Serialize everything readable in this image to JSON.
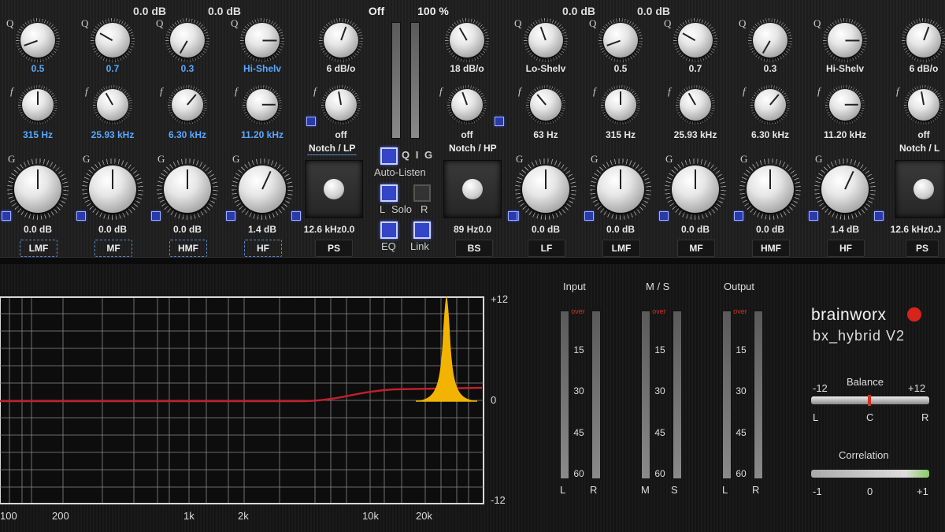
{
  "top_values": {
    "left_a": "0.0 dB",
    "left_b": "0.0 dB",
    "off": "Off",
    "pct": "100 %",
    "right_a": "0.0 dB",
    "right_b": "0.0 dB"
  },
  "row1": [
    "0.5",
    "0.7",
    "0.3",
    "Hi-Shelv",
    "6 dB/o",
    "18 dB/o",
    "Lo-Shelv",
    "0.5",
    "0.7",
    "0.3",
    "Hi-Shelv",
    "6 dB/o"
  ],
  "row2": [
    "315 Hz",
    "25.93 kHz",
    "6.30 kHz",
    "11.20 kHz",
    "off",
    "off",
    "63 Hz",
    "315 Hz",
    "25.93 kHz",
    "6.30 kHz",
    "11.20 kHz",
    "off"
  ],
  "row3": [
    "0.0 dB",
    "0.0 dB",
    "0.0 dB",
    "1.4 dB",
    "0.0 dB",
    "0.0 dB",
    "0.0 dB",
    "0.0 dB",
    "0.0 dB",
    "1.4 dB"
  ],
  "bands_left": [
    "LMF",
    "MF",
    "HMF",
    "HF"
  ],
  "bands_right": [
    "LF",
    "LMF",
    "MF",
    "HMF",
    "HF"
  ],
  "notch_lp": "Notch / LP",
  "notch_hp": "Notch / HP",
  "notch_l": "Notch / L",
  "ps_left": "12.6 kHz0.0",
  "ps_right": "12.6 kHz0.J",
  "bs_val": "89 Hz0.0",
  "ps_label": "PS",
  "bs_label": "BS",
  "qig": "Q I G",
  "auto_listen": "Auto-Listen",
  "solo_l": "L",
  "solo": "Solo",
  "solo_r": "R",
  "eq": "EQ",
  "link": "Link",
  "graph": {
    "top": "+12",
    "zero": "0",
    "bottom": "-12",
    "x": [
      "100",
      "200",
      "1k",
      "2k",
      "10k",
      "20k"
    ]
  },
  "meters": {
    "input": "Input",
    "ms": "M / S",
    "output": "Output",
    "over": "over",
    "scale": [
      "15",
      "30",
      "45",
      "60"
    ],
    "in_l": "L",
    "in_r": "R",
    "ms_m": "M",
    "ms_s": "S",
    "out_l": "L",
    "out_r": "R"
  },
  "brand": {
    "name": "brainworx",
    "product": "bx_hybrid V2"
  },
  "balance": {
    "label": "Balance",
    "min": "-12",
    "max": "+12",
    "l": "L",
    "c": "C",
    "r": "R"
  },
  "correlation": {
    "label": "Correlation",
    "min": "-1",
    "mid": "0",
    "max": "+1"
  },
  "colors": {
    "accent": "#3346c8",
    "value_blue": "#5aa8ff",
    "curve": "#c0202a",
    "peak": "#f2b400"
  }
}
